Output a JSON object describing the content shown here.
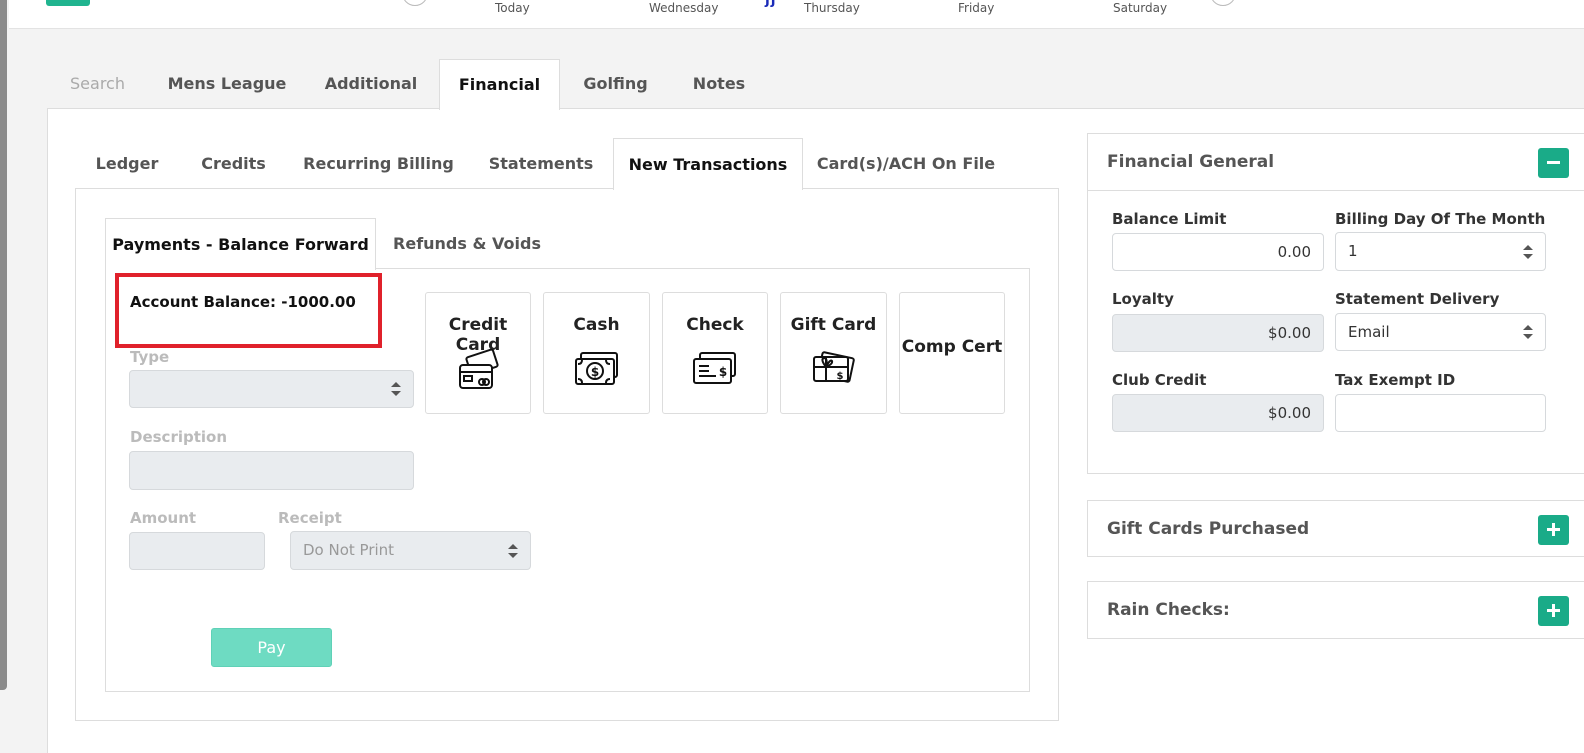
{
  "weekdays": [
    "Today",
    "Wednesday",
    "Thursday",
    "Friday",
    "Saturday"
  ],
  "page_tabs": [
    {
      "label": "Search"
    },
    {
      "label": "Mens League"
    },
    {
      "label": "Additional"
    },
    {
      "label": "Financial"
    },
    {
      "label": "Golfing"
    },
    {
      "label": "Notes"
    }
  ],
  "sub_tabs": [
    {
      "label": "Ledger"
    },
    {
      "label": "Credits"
    },
    {
      "label": "Recurring Billing"
    },
    {
      "label": "Statements"
    },
    {
      "label": "New Transactions"
    },
    {
      "label": "Card(s)/ACH On File"
    }
  ],
  "pay_tabs": [
    {
      "label": "Payments - Balance Forward"
    },
    {
      "label": "Refunds & Voids"
    }
  ],
  "account_balance": "Account Balance: -1000.00",
  "form": {
    "type_label": "Type",
    "type_value": "",
    "description_label": "Description",
    "description_value": "",
    "amount_label": "Amount",
    "amount_value": "",
    "receipt_label": "Receipt",
    "receipt_value": "Do Not Print",
    "pay_label": "Pay"
  },
  "methods": [
    {
      "label": "Credit Card",
      "icon": "credit-card-icon"
    },
    {
      "label": "Cash",
      "icon": "cash-icon"
    },
    {
      "label": "Check",
      "icon": "check-icon"
    },
    {
      "label": "Gift Card",
      "icon": "gift-card-icon"
    },
    {
      "label": "Comp Cert",
      "icon": ""
    }
  ],
  "financial_general": {
    "title": "Financial General",
    "balance_limit_label": "Balance Limit",
    "balance_limit_value": "0.00",
    "billing_day_label": "Billing Day Of The Month",
    "billing_day_value": "1",
    "loyalty_label": "Loyalty",
    "loyalty_value": "$0.00",
    "statement_delivery_label": "Statement Delivery",
    "statement_delivery_value": "Email",
    "club_credit_label": "Club Credit",
    "club_credit_value": "$0.00",
    "tax_exempt_label": "Tax Exempt ID",
    "tax_exempt_value": ""
  },
  "gift_cards_title": "Gift Cards Purchased",
  "rain_checks_title": "Rain Checks:",
  "colors": {
    "accent": "#1aab88",
    "pay_button": "#6edbc2",
    "highlight": "#e0212b"
  }
}
